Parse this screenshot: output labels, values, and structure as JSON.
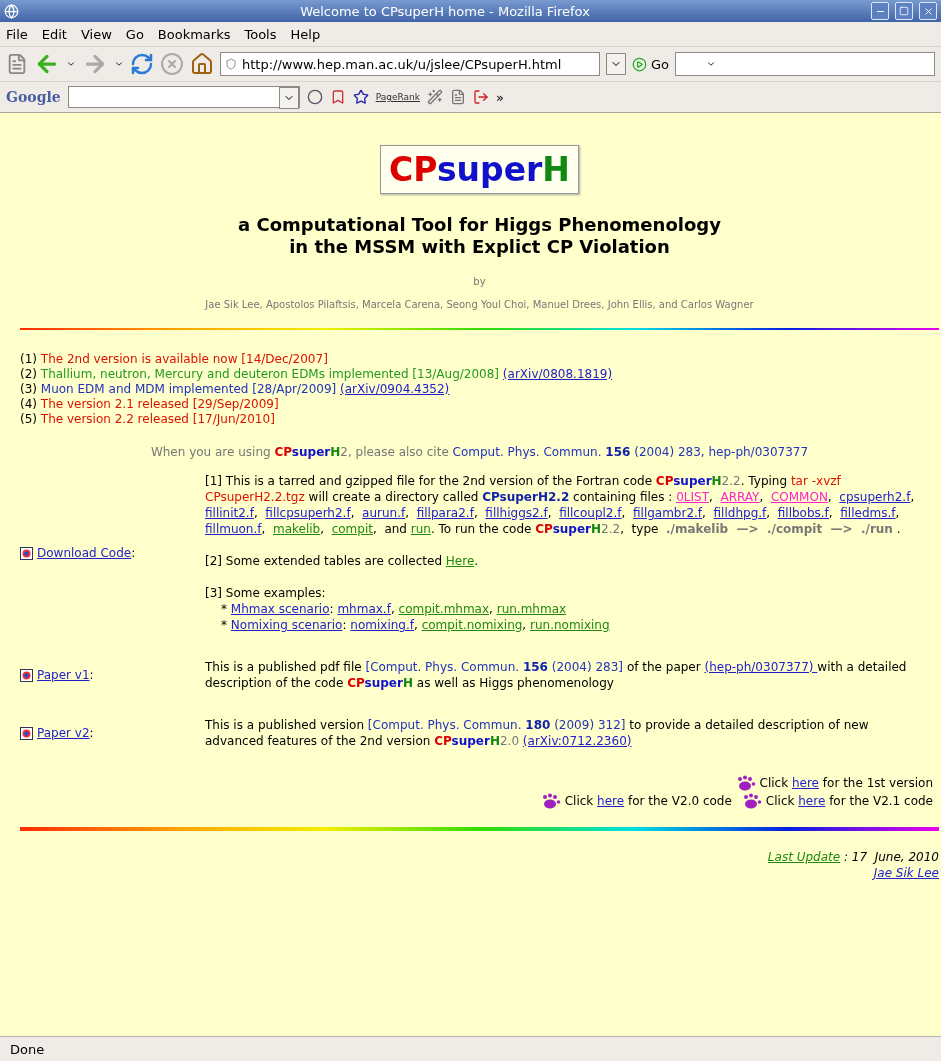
{
  "window": {
    "title": "Welcome to CPsuperH home - Mozilla Firefox"
  },
  "menu": [
    "File",
    "Edit",
    "View",
    "Go",
    "Bookmarks",
    "Tools",
    "Help"
  ],
  "nav": {
    "url": "http://www.hep.man.ac.uk/u/jslee/CPsuperH.html",
    "go": "Go"
  },
  "google_toolbar": {
    "logo": "Google",
    "pagerank": "PageRank",
    "more": "»"
  },
  "logo": [
    {
      "text": "CP",
      "kind": "cp"
    },
    {
      "text": "super",
      "kind": "super"
    },
    {
      "text": "H",
      "kind": "h"
    }
  ],
  "heading": [
    "a Computational Tool for Higgs Phenomenology",
    "in the MSSM with Explict CP Violation"
  ],
  "by": "by",
  "authors": "Jae Sik Lee, Apostolos Pilaftsis, Marcela Carena, Seong Youl Choi, Manuel Drees, John Ellis, and Carlos Wagner",
  "news": [
    [
      {
        "text": "(1) ",
        "kind": "text"
      },
      {
        "text": "The 2nd version is available now [14/Dec/2007]",
        "kind": "red"
      }
    ],
    [
      {
        "text": "(2) ",
        "kind": "text"
      },
      {
        "text": "Thallium, neutron, Mercury and deuteron EDMs implemented [13/Aug/2008] ",
        "kind": "green"
      },
      {
        "text": "(arXiv/0808.1819) ",
        "kind": "link"
      }
    ],
    [
      {
        "text": "(3) ",
        "kind": "text"
      },
      {
        "text": "Muon EDM and MDM implemented [28/Apr/2009] ",
        "kind": "blue"
      },
      {
        "text": "(arXiv/0904.4352) ",
        "kind": "link"
      }
    ],
    [
      {
        "text": "(4) ",
        "kind": "text"
      },
      {
        "text": "The version 2.1 released [29/Sep/2009]",
        "kind": "red"
      }
    ],
    [
      {
        "text": "(5) ",
        "kind": "text"
      },
      {
        "text": "The version 2.2 released [17/Jun/2010]",
        "kind": "red"
      }
    ]
  ],
  "cite": [
    {
      "text": "When you are using ",
      "kind": "gray"
    },
    {
      "text": "CP",
      "kind": "cp"
    },
    {
      "text": "super",
      "kind": "super"
    },
    {
      "text": "H",
      "kind": "h"
    },
    {
      "text": "2, please also cite ",
      "kind": "gray"
    },
    {
      "text": "Comput. Phys. Commun. ",
      "kind": "blue"
    },
    {
      "text": "156",
      "kind": "bold-blue"
    },
    {
      "text": " (2004) 283, hep-ph/0307377",
      "kind": "blue"
    }
  ],
  "rows": [
    {
      "label": "Download Code",
      "suffix": ":",
      "blocks": [
        {
          "kind": "para",
          "segments": [
            {
              "text": "[1] This is a tarred and gzipped file for the 2nd version of the Fortran code ",
              "kind": "text"
            },
            {
              "text": "CP",
              "kind": "cp"
            },
            {
              "text": "super",
              "kind": "super"
            },
            {
              "text": "H",
              "kind": "h"
            },
            {
              "text": "2.2",
              "kind": "gray"
            },
            {
              "text": ". Typing ",
              "kind": "text"
            },
            {
              "text": "tar -xvzf CPsuperH2.2.tgz",
              "kind": "red"
            },
            {
              "text": " will create a directory called ",
              "kind": "text"
            },
            {
              "text": "CPsuperH2.2",
              "kind": "bold-blue"
            },
            {
              "text": " containing files : ",
              "kind": "text"
            },
            {
              "text": "0LIST",
              "kind": "pink-link"
            },
            {
              "text": ",  ",
              "kind": "text"
            },
            {
              "text": "ARRAY",
              "kind": "pink-link"
            },
            {
              "text": ",  ",
              "kind": "text"
            },
            {
              "text": "COMMON",
              "kind": "pink-link"
            },
            {
              "text": ",  ",
              "kind": "text"
            },
            {
              "text": "cpsuperh2.f",
              "kind": "link"
            },
            {
              "text": ",  ",
              "kind": "text"
            },
            {
              "text": "fillinit2.f",
              "kind": "link"
            },
            {
              "text": ",  ",
              "kind": "text"
            },
            {
              "text": "fillcpsuperh2.f",
              "kind": "link"
            },
            {
              "text": ",  ",
              "kind": "text"
            },
            {
              "text": "aurun.f",
              "kind": "link"
            },
            {
              "text": ",  ",
              "kind": "text"
            },
            {
              "text": "fillpara2.f",
              "kind": "link"
            },
            {
              "text": ",  ",
              "kind": "text"
            },
            {
              "text": "fillhiggs2.f",
              "kind": "link"
            },
            {
              "text": ",  ",
              "kind": "text"
            },
            {
              "text": "fillcoupl2.f",
              "kind": "link"
            },
            {
              "text": ",  ",
              "kind": "text"
            },
            {
              "text": "fillgambr2.f",
              "kind": "link"
            },
            {
              "text": ",  ",
              "kind": "text"
            },
            {
              "text": "filldhpg.f",
              "kind": "link"
            },
            {
              "text": ",  ",
              "kind": "text"
            },
            {
              "text": "fillbobs.f",
              "kind": "link"
            },
            {
              "text": ",  ",
              "kind": "text"
            },
            {
              "text": "filledms.f",
              "kind": "link"
            },
            {
              "text": ",  ",
              "kind": "text"
            },
            {
              "text": "fillmuon.f",
              "kind": "link"
            },
            {
              "text": ",  ",
              "kind": "text"
            },
            {
              "text": "makelib",
              "kind": "green-link"
            },
            {
              "text": ",  ",
              "kind": "text"
            },
            {
              "text": "compit",
              "kind": "green-link"
            },
            {
              "text": ",  and ",
              "kind": "text"
            },
            {
              "text": "run",
              "kind": "green-link"
            },
            {
              "text": ". To run the code ",
              "kind": "text"
            },
            {
              "text": "CP",
              "kind": "cp"
            },
            {
              "text": "super",
              "kind": "super"
            },
            {
              "text": "H",
              "kind": "h"
            },
            {
              "text": "2.2",
              "kind": "gray"
            },
            {
              "text": ",  type  ",
              "kind": "text"
            },
            {
              "text": "./makelib  —>  ./compit  —>  ./run",
              "kind": "cmd"
            },
            {
              "text": " .",
              "kind": "text"
            }
          ]
        },
        {
          "kind": "para",
          "segments": [
            {
              "text": "[2] Some extended tables are collected ",
              "kind": "text"
            },
            {
              "text": "Here",
              "kind": "green-link"
            },
            {
              "text": ".",
              "kind": "text"
            }
          ]
        },
        {
          "kind": "para",
          "segments": [
            {
              "text": "[3] Some examples:",
              "kind": "text"
            }
          ]
        },
        {
          "kind": "sub",
          "segments": [
            {
              "text": "* ",
              "kind": "text"
            },
            {
              "text": "Mhmax scenario",
              "kind": "link"
            },
            {
              "text": ": ",
              "kind": "text"
            },
            {
              "text": "mhmax.f",
              "kind": "link"
            },
            {
              "text": ", ",
              "kind": "text"
            },
            {
              "text": "compit.mhmax",
              "kind": "green-link"
            },
            {
              "text": ", ",
              "kind": "text"
            },
            {
              "text": "run.mhmax",
              "kind": "green-link"
            }
          ]
        },
        {
          "kind": "sub",
          "segments": [
            {
              "text": "* ",
              "kind": "text"
            },
            {
              "text": "Nomixing scenario",
              "kind": "link"
            },
            {
              "text": ": ",
              "kind": "text"
            },
            {
              "text": "nomixing.f",
              "kind": "link"
            },
            {
              "text": ", ",
              "kind": "text"
            },
            {
              "text": "compit.nomixing",
              "kind": "green-link"
            },
            {
              "text": ", ",
              "kind": "text"
            },
            {
              "text": "run.nomixing",
              "kind": "green-link"
            }
          ]
        }
      ]
    },
    {
      "label": "Paper v1",
      "suffix": ":",
      "blocks": [
        {
          "kind": "para",
          "segments": [
            {
              "text": "This is a published pdf file ",
              "kind": "text"
            },
            {
              "text": "[Comput. Phys. Commun. ",
              "kind": "blue"
            },
            {
              "text": "156",
              "kind": "bold-blue"
            },
            {
              "text": " (2004) 283]",
              "kind": "blue"
            },
            {
              "text": " of the paper ",
              "kind": "text"
            },
            {
              "text": "(hep-ph/0307377) ",
              "kind": "link"
            },
            {
              "text": "with a detailed description of the code ",
              "kind": "text"
            },
            {
              "text": "CP",
              "kind": "cp"
            },
            {
              "text": "super",
              "kind": "super"
            },
            {
              "text": "H",
              "kind": "h"
            },
            {
              "text": " as well as Higgs phenomenology",
              "kind": "text"
            }
          ]
        }
      ]
    },
    {
      "label": "Paper v2",
      "suffix": ":",
      "blocks": [
        {
          "kind": "para",
          "segments": [
            {
              "text": "This is a published version ",
              "kind": "text"
            },
            {
              "text": "[Comput. Phys. Commun. ",
              "kind": "blue"
            },
            {
              "text": "180",
              "kind": "bold-blue"
            },
            {
              "text": " (2009) 312]",
              "kind": "blue"
            },
            {
              "text": " to provide a detailed description of new advanced features of the 2nd version ",
              "kind": "text"
            },
            {
              "text": "CP",
              "kind": "cp"
            },
            {
              "text": "super",
              "kind": "super"
            },
            {
              "text": "H",
              "kind": "h"
            },
            {
              "text": "2.0 ",
              "kind": "gray"
            },
            {
              "text": "(arXiv:0712.2360)",
              "kind": "link"
            }
          ]
        }
      ]
    }
  ],
  "click_rows": [
    [
      [
        {
          "text": "Click ",
          "kind": "text"
        },
        {
          "text": "here",
          "kind": "link"
        },
        {
          "text": " for the 1st version",
          "kind": "text"
        }
      ]
    ],
    [
      [
        {
          "text": "Click ",
          "kind": "text"
        },
        {
          "text": "here",
          "kind": "link"
        },
        {
          "text": " for the V2.0 code",
          "kind": "text"
        }
      ],
      [
        {
          "text": "Click ",
          "kind": "text"
        },
        {
          "text": "here",
          "kind": "link"
        },
        {
          "text": " for the V2.1 code",
          "kind": "text"
        }
      ]
    ]
  ],
  "footer": {
    "update_link": "Last Update",
    "date": " : 17  June, 2010",
    "author": "Jae Sik Lee"
  },
  "status": "Done"
}
